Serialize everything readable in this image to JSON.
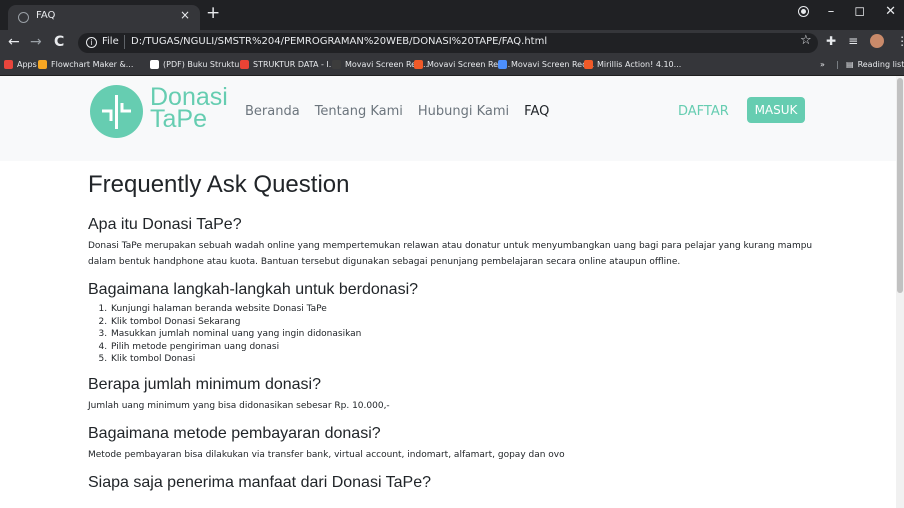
{
  "browser": {
    "tab_title": "FAQ",
    "tab_close": "×",
    "new_tab": "+",
    "url_scheme": "File",
    "url": "D:/TUGAS/NGULI/SMSTR%204/PEMROGRAMAN%20WEB/DONASI%20TAPE/FAQ.html",
    "back": "←",
    "forward": "→",
    "reload": "C",
    "minimize": "–",
    "maximize": "◻",
    "close": "✕",
    "bookmarks": [
      {
        "label": "Apps",
        "color": "#e8453c"
      },
      {
        "label": "Flowchart Maker &...",
        "color": "#f6a623"
      },
      {
        "label": "(PDF) Buku Struktur...",
        "color": "#ffffff"
      },
      {
        "label": "STRUKTUR DATA - I...",
        "color": "#ea4335"
      },
      {
        "label": "Movavi Screen Rec...",
        "color": "#3c3c3c"
      },
      {
        "label": "Movavi Screen Rec...",
        "color": "#f05a28"
      },
      {
        "label": "Movavi Screen Rec...",
        "color": "#4d90fe"
      },
      {
        "label": "Mirillis Action! 4.10...",
        "color": "#f05a28"
      }
    ],
    "bookmarks_more": "»",
    "reading_list": "Reading list"
  },
  "navbar": {
    "logo_line1": "Donasi",
    "logo_line2": "TaPe",
    "links": [
      "Beranda",
      "Tentang Kami",
      "Hubungi Kami",
      "FAQ"
    ],
    "active_link": "FAQ",
    "daftar": "DAFTAR",
    "masuk": "MASUK",
    "accent_color": "#66cdb1"
  },
  "faq": {
    "title": "Frequently Ask Question",
    "items": [
      {
        "question": "Apa itu Donasi TaPe?",
        "answer": "Donasi TaPe merupakan sebuah wadah online yang mempertemukan relawan atau donatur untuk menyumbangkan uang bagi para pelajar yang kurang mampu dalam bentuk handphone atau kuota. Bantuan tersebut digunakan sebagai penunjang pembelajaran secara online ataupun offline."
      },
      {
        "question": "Bagaimana langkah-langkah untuk berdonasi?",
        "steps": [
          "Kunjungi halaman beranda website Donasi TaPe",
          "Klik tombol Donasi Sekarang",
          "Masukkan jumlah nominal uang yang ingin didonasikan",
          "Pilih metode pengiriman uang donasi",
          "Klik tombol Donasi"
        ]
      },
      {
        "question": "Berapa jumlah minimum donasi?",
        "answer": "Jumlah uang minimum yang bisa didonasikan sebesar Rp. 10.000,-"
      },
      {
        "question": "Bagaimana metode pembayaran donasi?",
        "answer": "Metode pembayaran bisa dilakukan via transfer bank, virtual account, indomart, alfamart, gopay dan ovo"
      },
      {
        "question": "Siapa saja penerima manfaat dari Donasi TaPe?"
      }
    ]
  }
}
